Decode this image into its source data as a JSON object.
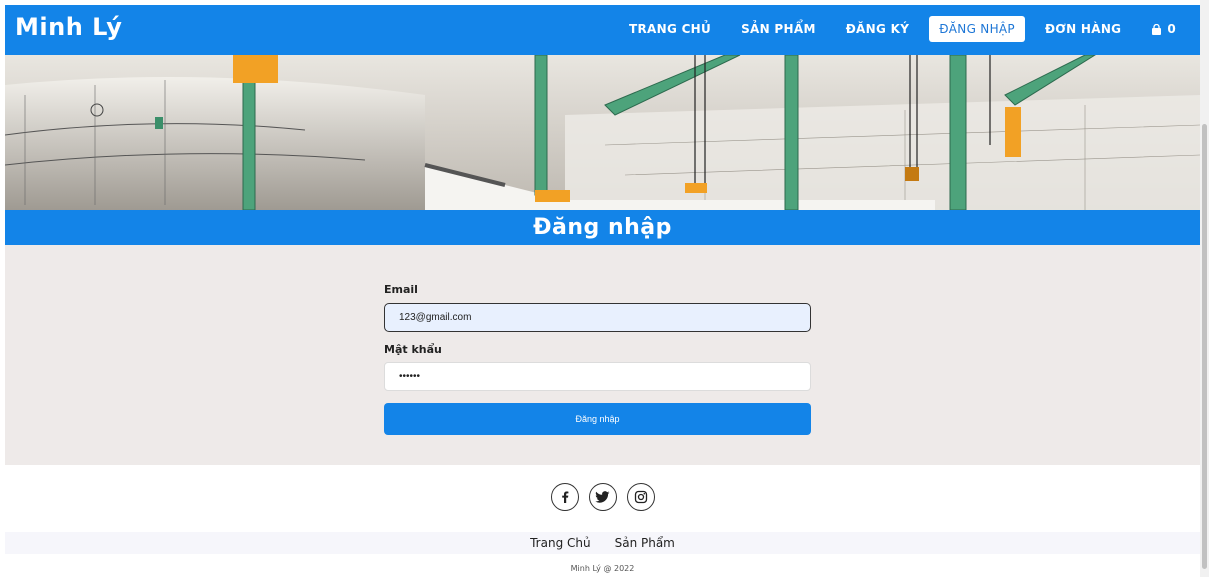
{
  "navbar": {
    "brand": "Minh Lý",
    "links": [
      {
        "label": "TRANG CHỦ"
      },
      {
        "label": "SẢN PHẨM"
      },
      {
        "label": "ĐĂNG KÝ"
      },
      {
        "label": "ĐĂNG NHẬP",
        "active": true
      },
      {
        "label": "ĐƠN HÀNG"
      }
    ],
    "cart_count": "0",
    "cart_icon": "shopping-bag-icon"
  },
  "page_title": "Đăng nhập",
  "form": {
    "email_label": "Email",
    "email_value": "123@gmail.com",
    "password_label": "Mật khẩu",
    "password_value": "••••••",
    "submit_label": "Đăng nhập"
  },
  "footer": {
    "social": [
      "facebook-icon",
      "twitter-icon",
      "instagram-icon"
    ],
    "links": [
      {
        "label": "Trang Chủ"
      },
      {
        "label": "Sản Phẩm"
      }
    ],
    "copyright": "Minh Lý @ 2022"
  },
  "colors": {
    "primary": "#1384e8",
    "form_bg": "#eeeae9",
    "active_link_text": "#1d76d6"
  }
}
